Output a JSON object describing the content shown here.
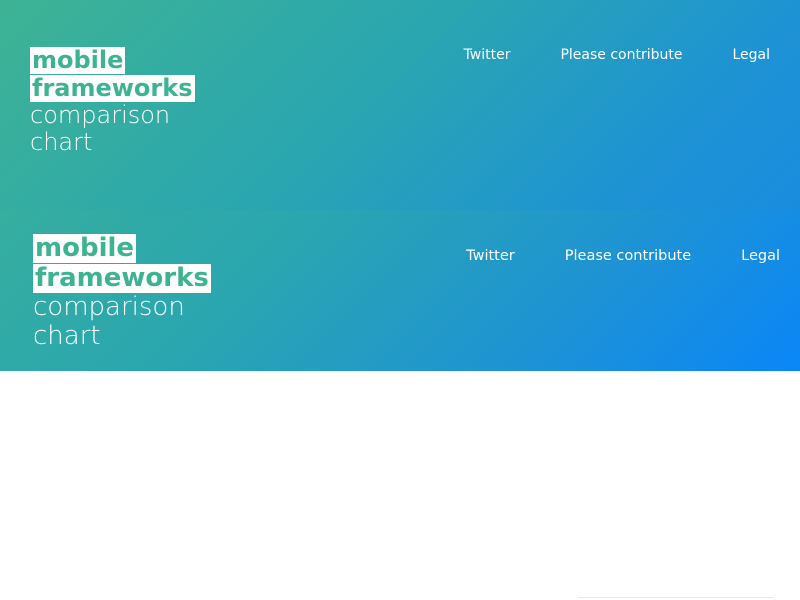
{
  "header": {
    "brand": {
      "line1": "mobile",
      "line2": "frameworks",
      "line3": "comparison",
      "line4": "chart"
    },
    "nav": [
      {
        "label": "Twitter"
      },
      {
        "label": "Please contribute"
      },
      {
        "label": "Legal"
      }
    ]
  },
  "colors": {
    "gradient_start": "#3eb394",
    "gradient_end": "#0a86f8",
    "highlight_text": "#3eb394"
  }
}
